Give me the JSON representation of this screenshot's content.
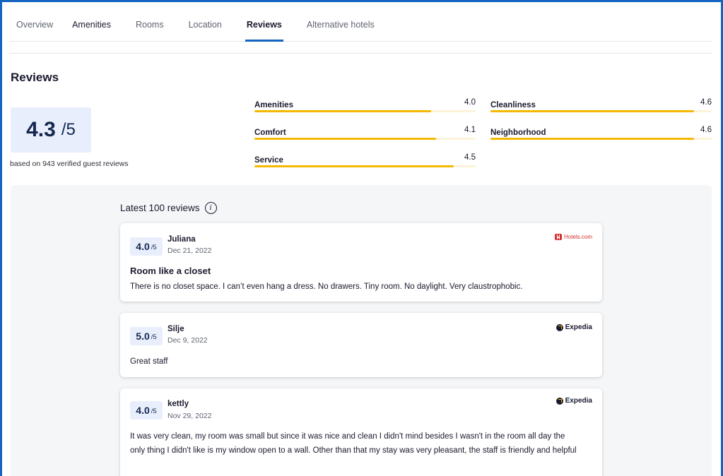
{
  "tabs": [
    {
      "label": "Overview"
    },
    {
      "label": "Amenities"
    },
    {
      "label": "Rooms"
    },
    {
      "label": "Location"
    },
    {
      "label": "Reviews"
    },
    {
      "label": "Alternative hotels"
    }
  ],
  "active_tab": "Reviews",
  "reviews": {
    "heading": "Reviews",
    "overall_score": "4.3",
    "overall_denominator": "/5",
    "caption": "based on 943 verified guest reviews"
  },
  "metrics": [
    {
      "label": "Amenities",
      "value": "4.0",
      "fraction": 0.8
    },
    {
      "label": "Cleanliness",
      "value": "4.6",
      "fraction": 0.92
    },
    {
      "label": "Comfort",
      "value": "4.1",
      "fraction": 0.82
    },
    {
      "label": "Neighborhood",
      "value": "4.6",
      "fraction": 0.92
    },
    {
      "label": "Service",
      "value": "4.5",
      "fraction": 0.9
    }
  ],
  "latest": {
    "label": "Latest 100 reviews",
    "info_icon": "info-icon"
  },
  "review_cards": [
    {
      "rating": "4.0",
      "denominator": "/5",
      "reviewer": "Juliana",
      "date": "Dec 21, 2022",
      "source": "Hotels.com",
      "title": "Room like a closet",
      "text": "There is no closet space. I can’t even hang a dress. No drawers. Tiny room. No daylight. Very claustrophobic."
    },
    {
      "rating": "5.0",
      "denominator": "/5",
      "reviewer": "Silje",
      "date": "Dec 9, 2022",
      "source": "Expedia",
      "title": "",
      "text": "Great staff"
    },
    {
      "rating": "4.0",
      "denominator": "/5",
      "reviewer": "kettly",
      "date": "Nov 29, 2022",
      "source": "Expedia",
      "title": "",
      "text": "It was very clean, my room was small but since it was nice and clean I didn't mind besides I wasn't in the room all day the only thing I didn't like is my window open to a wall. Other than that my stay was very pleasant, the staff is friendly and helpful"
    }
  ],
  "colors": {
    "accent": "#1565c0",
    "bar_fill": "#f5b800",
    "score_bg": "#e8eefc",
    "panel_bg": "#f5f6f8"
  }
}
